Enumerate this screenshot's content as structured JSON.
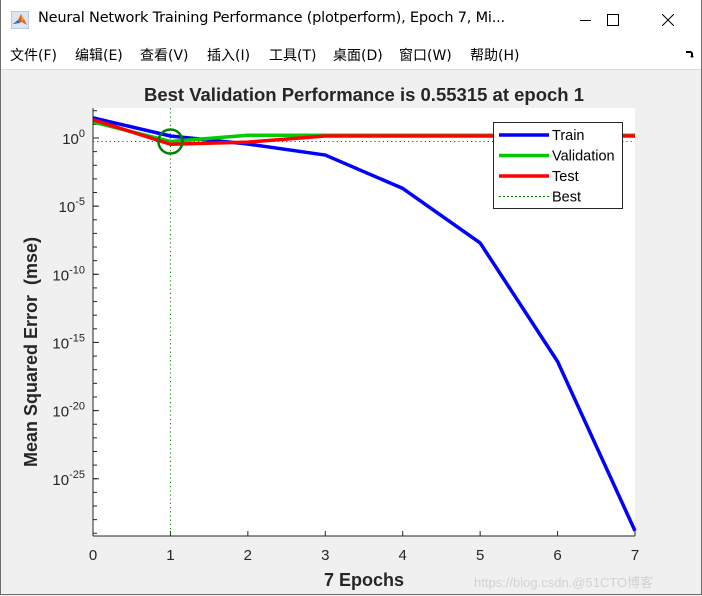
{
  "window": {
    "title": "Neural Network Training Performance (plotperform), Epoch 7, Mi...",
    "controls": {
      "minimize": "minimize",
      "maximize": "maximize",
      "close": "close"
    }
  },
  "menubar": {
    "items": [
      {
        "label": "文件(F)",
        "key": "F"
      },
      {
        "label": "编辑(E)",
        "key": "E"
      },
      {
        "label": "查看(V)",
        "key": "V"
      },
      {
        "label": "插入(I)",
        "key": "I"
      },
      {
        "label": "工具(T)",
        "key": "T"
      },
      {
        "label": "桌面(D)",
        "key": "D"
      },
      {
        "label": "窗口(W)",
        "key": "W"
      },
      {
        "label": "帮助(H)",
        "key": "H"
      }
    ],
    "dock_icon": "dock-arrow-icon"
  },
  "chart_data": {
    "type": "line",
    "title": "Best Validation Performance is 0.55315 at epoch 1",
    "xlabel": "7 Epochs",
    "ylabel": "Mean Squared Error  (mse)",
    "yscale": "log",
    "xlim": [
      0,
      7
    ],
    "ylim_log10": [
      -29.2,
      2.2
    ],
    "x_ticks": [
      "0",
      "1",
      "2",
      "3",
      "4",
      "5",
      "6",
      "7"
    ],
    "y_ticks": [
      {
        "exp": 0,
        "base": "10",
        "sup": "0"
      },
      {
        "exp": -5,
        "base": "10",
        "sup": "-5"
      },
      {
        "exp": -10,
        "base": "10",
        "sup": "-10"
      },
      {
        "exp": -15,
        "base": "10",
        "sup": "-15"
      },
      {
        "exp": -20,
        "base": "10",
        "sup": "-20"
      },
      {
        "exp": -25,
        "base": "10",
        "sup": "-25"
      }
    ],
    "x": [
      0,
      1,
      2,
      3,
      4,
      5,
      6,
      7
    ],
    "series": [
      {
        "name": "Train",
        "color": "#0000ff",
        "values": [
          30,
          1.4,
          0.36,
          0.056,
          0.0002,
          2e-08,
          4e-17,
          1.5e-29
        ]
      },
      {
        "name": "Validation",
        "color": "#00cc00",
        "values": [
          15,
          0.55315,
          1.6,
          1.6,
          1.6,
          1.6,
          1.6,
          1.6
        ]
      },
      {
        "name": "Test",
        "color": "#ff0000",
        "values": [
          22,
          0.35,
          0.5,
          1.4,
          1.4,
          1.4,
          1.4,
          1.4
        ]
      }
    ],
    "best": {
      "name": "Best",
      "epoch": 1,
      "value": 0.55315,
      "color": "#008000"
    },
    "legend": {
      "position": "top-right",
      "entries": [
        "Train",
        "Validation",
        "Test",
        "Best"
      ]
    },
    "grid": false
  },
  "watermark": "https://blog.csdn.@51CTO博客"
}
